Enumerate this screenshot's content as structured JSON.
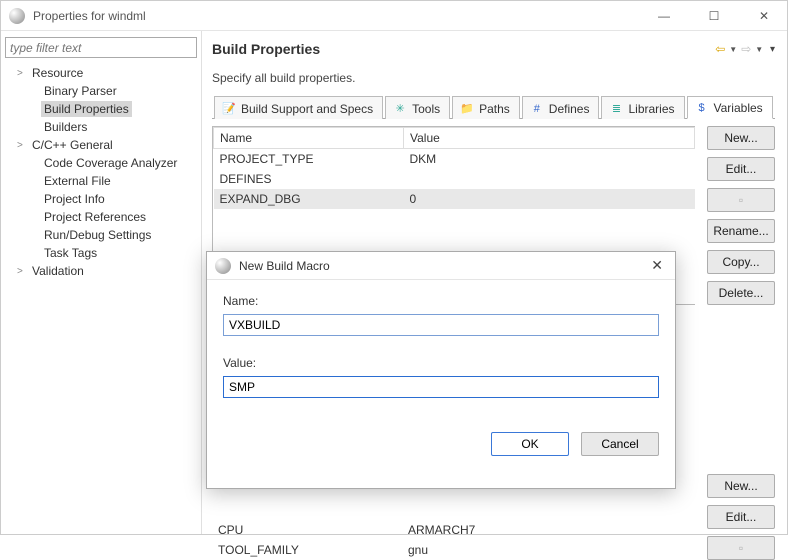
{
  "window": {
    "title": "Properties for windml",
    "min": "—",
    "max": "☐",
    "close": "✕"
  },
  "filter": {
    "placeholder": "type filter text"
  },
  "tree": [
    {
      "label": "Resource",
      "caret": true
    },
    {
      "label": "Binary Parser"
    },
    {
      "label": "Build Properties",
      "selected": true
    },
    {
      "label": "Builders"
    },
    {
      "label": "C/C++ General",
      "caret": true
    },
    {
      "label": "Code Coverage Analyzer"
    },
    {
      "label": "External File"
    },
    {
      "label": "Project Info"
    },
    {
      "label": "Project References"
    },
    {
      "label": "Run/Debug Settings"
    },
    {
      "label": "Task Tags"
    },
    {
      "label": "Validation",
      "caret": true
    }
  ],
  "page": {
    "heading": "Build Properties",
    "desc": "Specify all build properties."
  },
  "tabs": [
    {
      "label": "Build Support and Specs",
      "icon": "📝",
      "color": "#2a7"
    },
    {
      "label": "Tools",
      "icon": "✳",
      "color": "#3a9"
    },
    {
      "label": "Paths",
      "icon": "📁",
      "color": "#d9a300"
    },
    {
      "label": "Defines",
      "icon": "#",
      "color": "#36c"
    },
    {
      "label": "Libraries",
      "icon": "≣",
      "color": "#3a9"
    },
    {
      "label": "Variables",
      "icon": "$",
      "color": "#36c",
      "active": true
    }
  ],
  "table": {
    "headers": [
      "Name",
      "Value"
    ],
    "rows": [
      {
        "name": "PROJECT_TYPE",
        "value": "DKM"
      },
      {
        "name": "DEFINES",
        "value": ""
      },
      {
        "name": "EXPAND_DBG",
        "value": "0",
        "selected": true
      }
    ],
    "lower_rows": [
      {
        "name": "CPU",
        "value": "ARMARCH7"
      },
      {
        "name": "TOOL_FAMILY",
        "value": "gnu"
      }
    ]
  },
  "buttons": {
    "new": "New...",
    "edit": "Edit...",
    "rename": "Rename...",
    "copy": "Copy...",
    "delete": "Delete..."
  },
  "dialog": {
    "title": "New Build Macro",
    "name_label": "Name:",
    "name_value": "VXBUILD",
    "value_label": "Value:",
    "value_value": "SMP",
    "ok": "OK",
    "cancel": "Cancel"
  }
}
